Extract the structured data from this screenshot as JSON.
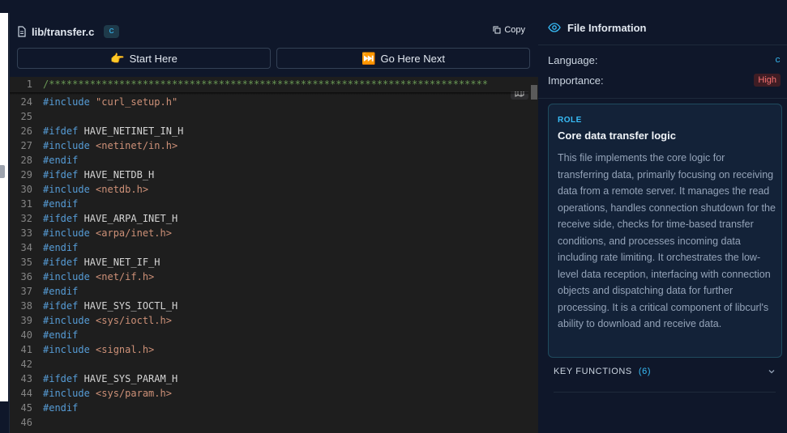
{
  "file": {
    "path": "lib/transfer.c",
    "language_badge": "c",
    "copy_label": "Copy"
  },
  "nav": {
    "start_icon": "👉",
    "start_label": "Start Here",
    "next_icon": "⏭️",
    "next_label": "Go Here Next"
  },
  "code": {
    "sticky": {
      "num": "1",
      "tokens": [
        {
          "t": "c",
          "v": "/***************************************************************************"
        }
      ]
    },
    "lines": [
      {
        "num": "24",
        "tokens": [
          {
            "t": "k",
            "v": "#include"
          },
          {
            "t": "i",
            "v": " "
          },
          {
            "t": "s",
            "v": "\"curl_setup.h\""
          }
        ]
      },
      {
        "num": "25",
        "tokens": []
      },
      {
        "num": "26",
        "tokens": [
          {
            "t": "k",
            "v": "#ifdef"
          },
          {
            "t": "i",
            "v": " HAVE_NETINET_IN_H"
          }
        ]
      },
      {
        "num": "27",
        "tokens": [
          {
            "t": "k",
            "v": "#include"
          },
          {
            "t": "i",
            "v": " "
          },
          {
            "t": "s",
            "v": "<netinet/in.h>"
          }
        ]
      },
      {
        "num": "28",
        "tokens": [
          {
            "t": "k",
            "v": "#endif"
          }
        ]
      },
      {
        "num": "29",
        "tokens": [
          {
            "t": "k",
            "v": "#ifdef"
          },
          {
            "t": "i",
            "v": " HAVE_NETDB_H"
          }
        ]
      },
      {
        "num": "30",
        "tokens": [
          {
            "t": "k",
            "v": "#include"
          },
          {
            "t": "i",
            "v": " "
          },
          {
            "t": "s",
            "v": "<netdb.h>"
          }
        ]
      },
      {
        "num": "31",
        "tokens": [
          {
            "t": "k",
            "v": "#endif"
          }
        ]
      },
      {
        "num": "32",
        "tokens": [
          {
            "t": "k",
            "v": "#ifdef"
          },
          {
            "t": "i",
            "v": " HAVE_ARPA_INET_H"
          }
        ]
      },
      {
        "num": "33",
        "tokens": [
          {
            "t": "k",
            "v": "#include"
          },
          {
            "t": "i",
            "v": " "
          },
          {
            "t": "s",
            "v": "<arpa/inet.h>"
          }
        ]
      },
      {
        "num": "34",
        "tokens": [
          {
            "t": "k",
            "v": "#endif"
          }
        ]
      },
      {
        "num": "35",
        "tokens": [
          {
            "t": "k",
            "v": "#ifdef"
          },
          {
            "t": "i",
            "v": " HAVE_NET_IF_H"
          }
        ]
      },
      {
        "num": "36",
        "tokens": [
          {
            "t": "k",
            "v": "#include"
          },
          {
            "t": "i",
            "v": " "
          },
          {
            "t": "s",
            "v": "<net/if.h>"
          }
        ]
      },
      {
        "num": "37",
        "tokens": [
          {
            "t": "k",
            "v": "#endif"
          }
        ]
      },
      {
        "num": "38",
        "tokens": [
          {
            "t": "k",
            "v": "#ifdef"
          },
          {
            "t": "i",
            "v": " HAVE_SYS_IOCTL_H"
          }
        ]
      },
      {
        "num": "39",
        "tokens": [
          {
            "t": "k",
            "v": "#include"
          },
          {
            "t": "i",
            "v": " "
          },
          {
            "t": "s",
            "v": "<sys/ioctl.h>"
          }
        ]
      },
      {
        "num": "40",
        "tokens": [
          {
            "t": "k",
            "v": "#endif"
          }
        ]
      },
      {
        "num": "41",
        "tokens": [
          {
            "t": "k",
            "v": "#include"
          },
          {
            "t": "i",
            "v": " "
          },
          {
            "t": "s",
            "v": "<signal.h>"
          }
        ]
      },
      {
        "num": "42",
        "tokens": []
      },
      {
        "num": "43",
        "tokens": [
          {
            "t": "k",
            "v": "#ifdef"
          },
          {
            "t": "i",
            "v": " HAVE_SYS_PARAM_H"
          }
        ]
      },
      {
        "num": "44",
        "tokens": [
          {
            "t": "k",
            "v": "#include"
          },
          {
            "t": "i",
            "v": " "
          },
          {
            "t": "s",
            "v": "<sys/param.h>"
          }
        ]
      },
      {
        "num": "45",
        "tokens": [
          {
            "t": "k",
            "v": "#endif"
          }
        ]
      },
      {
        "num": "46",
        "tokens": []
      }
    ]
  },
  "sidebar": {
    "title": "File Information",
    "language_label": "Language:",
    "language_value": "c",
    "importance_label": "Importance:",
    "importance_value": "High",
    "role": {
      "label": "ROLE",
      "title": "Core data transfer logic",
      "description": "This file implements the core logic for transferring data, primarily focusing on receiving data from a remote server. It manages the read operations, handles connection shutdown for the receive side, checks for time-based transfer conditions, and processes incoming data including rate limiting. It orchestrates the low-level data reception, interfacing with connection objects and dispatching data for further processing. It is a critical component of libcurl's ability to download and receive data."
    },
    "key_functions": {
      "label": "KEY FUNCTIONS",
      "count": "(6)"
    }
  },
  "colors": {
    "accent": "#38bdf8",
    "high_badge": "#f87171",
    "code_bg": "#1e1e1e",
    "keyword": "#569cd6",
    "string": "#ce9178",
    "comment": "#6a9955"
  }
}
